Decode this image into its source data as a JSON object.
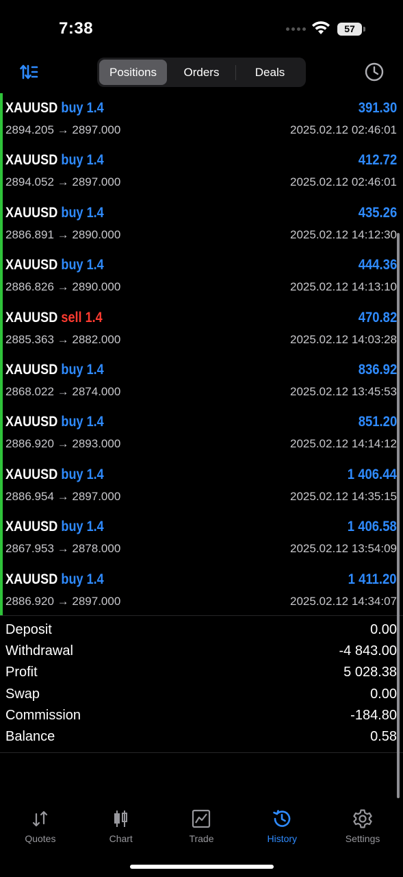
{
  "status_bar": {
    "time": "7:38",
    "battery": "57"
  },
  "header": {
    "tabs": [
      {
        "label": "Positions",
        "active": true
      },
      {
        "label": "Orders",
        "active": false
      },
      {
        "label": "Deals",
        "active": false
      }
    ]
  },
  "positions": [
    {
      "symbol": "XAUUSD",
      "side": "buy",
      "volume": "1.4",
      "profit": "391.30",
      "open": "2894.205",
      "arrow": "→",
      "close": "2897.000",
      "time": "2025.02.12 02:46:01"
    },
    {
      "symbol": "XAUUSD",
      "side": "buy",
      "volume": "1.4",
      "profit": "412.72",
      "open": "2894.052",
      "arrow": "→",
      "close": "2897.000",
      "time": "2025.02.12 02:46:01"
    },
    {
      "symbol": "XAUUSD",
      "side": "buy",
      "volume": "1.4",
      "profit": "435.26",
      "open": "2886.891",
      "arrow": "→",
      "close": "2890.000",
      "time": "2025.02.12 14:12:30"
    },
    {
      "symbol": "XAUUSD",
      "side": "buy",
      "volume": "1.4",
      "profit": "444.36",
      "open": "2886.826",
      "arrow": "→",
      "close": "2890.000",
      "time": "2025.02.12 14:13:10"
    },
    {
      "symbol": "XAUUSD",
      "side": "sell",
      "volume": "1.4",
      "profit": "470.82",
      "open": "2885.363",
      "arrow": "→",
      "close": "2882.000",
      "time": "2025.02.12 14:03:28"
    },
    {
      "symbol": "XAUUSD",
      "side": "buy",
      "volume": "1.4",
      "profit": "836.92",
      "open": "2868.022",
      "arrow": "→",
      "close": "2874.000",
      "time": "2025.02.12 13:45:53"
    },
    {
      "symbol": "XAUUSD",
      "side": "buy",
      "volume": "1.4",
      "profit": "851.20",
      "open": "2886.920",
      "arrow": "→",
      "close": "2893.000",
      "time": "2025.02.12 14:14:12"
    },
    {
      "symbol": "XAUUSD",
      "side": "buy",
      "volume": "1.4",
      "profit": "1 406.44",
      "open": "2886.954",
      "arrow": "→",
      "close": "2897.000",
      "time": "2025.02.12 14:35:15"
    },
    {
      "symbol": "XAUUSD",
      "side": "buy",
      "volume": "1.4",
      "profit": "1 406.58",
      "open": "2867.953",
      "arrow": "→",
      "close": "2878.000",
      "time": "2025.02.12 13:54:09"
    },
    {
      "symbol": "XAUUSD",
      "side": "buy",
      "volume": "1.4",
      "profit": "1 411.20",
      "open": "2886.920",
      "arrow": "→",
      "close": "2897.000",
      "time": "2025.02.12 14:34:07"
    }
  ],
  "summary": [
    {
      "label": "Deposit",
      "value": "0.00"
    },
    {
      "label": "Withdrawal",
      "value": "-4 843.00"
    },
    {
      "label": "Profit",
      "value": "5 028.38"
    },
    {
      "label": "Swap",
      "value": "0.00"
    },
    {
      "label": "Commission",
      "value": "-184.80"
    },
    {
      "label": "Balance",
      "value": "0.58"
    }
  ],
  "tabbar": [
    {
      "label": "Quotes",
      "icon": "quotes-icon",
      "active": false
    },
    {
      "label": "Chart",
      "icon": "chart-icon",
      "active": false
    },
    {
      "label": "Trade",
      "icon": "trade-icon",
      "active": false
    },
    {
      "label": "History",
      "icon": "history-icon",
      "active": true
    },
    {
      "label": "Settings",
      "icon": "settings-icon",
      "active": false
    }
  ],
  "colors": {
    "accent": "#2f8bff",
    "sell": "#ff3b30",
    "profit_bar": "#2fc33a",
    "muted_text": "#c8c8cc"
  }
}
